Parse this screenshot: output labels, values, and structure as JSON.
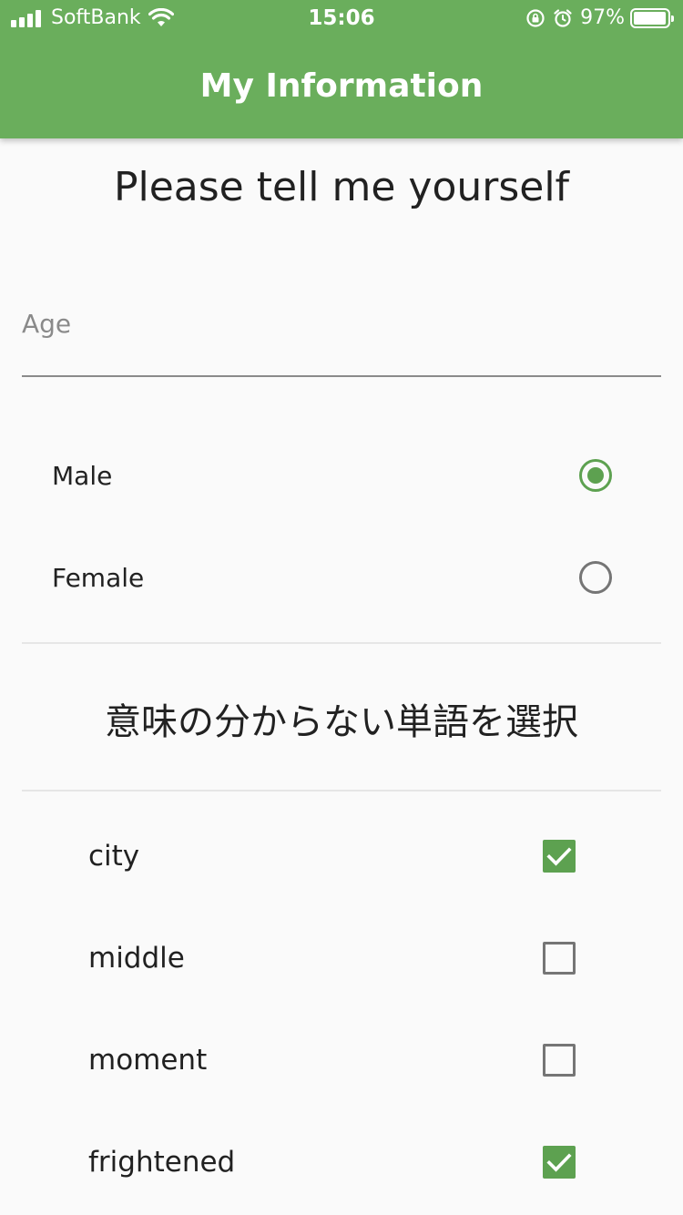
{
  "status_bar": {
    "carrier": "SoftBank",
    "time": "15:06",
    "battery_percent": "97%",
    "signal_icon": "signal-bars-icon",
    "wifi_icon": "wifi-icon",
    "orientation_lock_icon": "orientation-lock-icon",
    "alarm_icon": "alarm-icon",
    "battery_icon": "battery-icon",
    "battery_level": 0.97
  },
  "app_bar": {
    "title": "My Information",
    "color": "#6aae5c"
  },
  "form": {
    "heading": "Please tell me yourself",
    "age_placeholder": "Age",
    "age_value": "",
    "gender_options": [
      {
        "label": "Male",
        "selected": true
      },
      {
        "label": "Female",
        "selected": false
      }
    ],
    "word_section_heading": "意味の分からない単語を選択",
    "words": [
      {
        "label": "city",
        "checked": true
      },
      {
        "label": "middle",
        "checked": false
      },
      {
        "label": "moment",
        "checked": false
      },
      {
        "label": "frightened",
        "checked": true
      }
    ],
    "accent_color": "#5da150"
  }
}
